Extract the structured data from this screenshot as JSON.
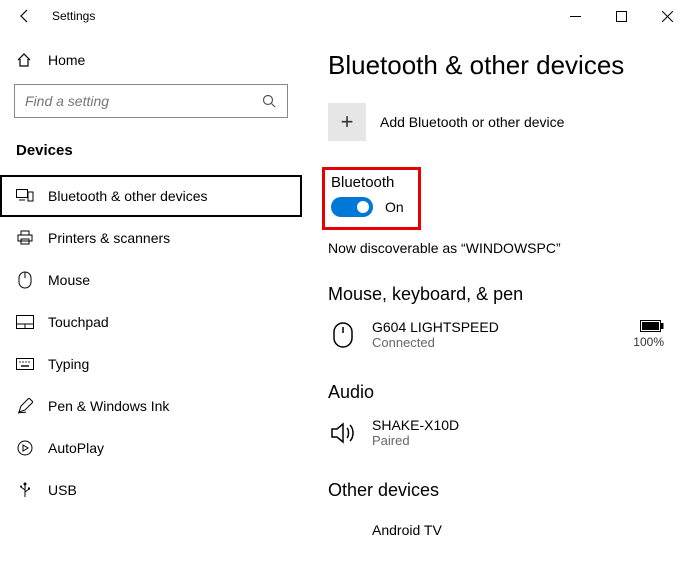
{
  "title": "Settings",
  "home_label": "Home",
  "search_placeholder": "Find a setting",
  "sidebar_section": "Devices",
  "sidebar": {
    "items": [
      {
        "label": "Bluetooth & other devices"
      },
      {
        "label": "Printers & scanners"
      },
      {
        "label": "Mouse"
      },
      {
        "label": "Touchpad"
      },
      {
        "label": "Typing"
      },
      {
        "label": "Pen & Windows Ink"
      },
      {
        "label": "AutoPlay"
      },
      {
        "label": "USB"
      }
    ]
  },
  "page_title": "Bluetooth & other devices",
  "add_device_label": "Add Bluetooth or other device",
  "bluetooth_label": "Bluetooth",
  "toggle_state": "On",
  "discoverable_text": "Now discoverable as “WINDOWSPC”",
  "section_mouse": "Mouse, keyboard, & pen",
  "device_mouse": {
    "name": "G604 LIGHTSPEED",
    "status": "Connected",
    "battery": "100%"
  },
  "section_audio": "Audio",
  "device_audio": {
    "name": "SHAKE-X10D",
    "status": "Paired"
  },
  "section_other": "Other devices",
  "device_other": {
    "name": "Android TV"
  }
}
